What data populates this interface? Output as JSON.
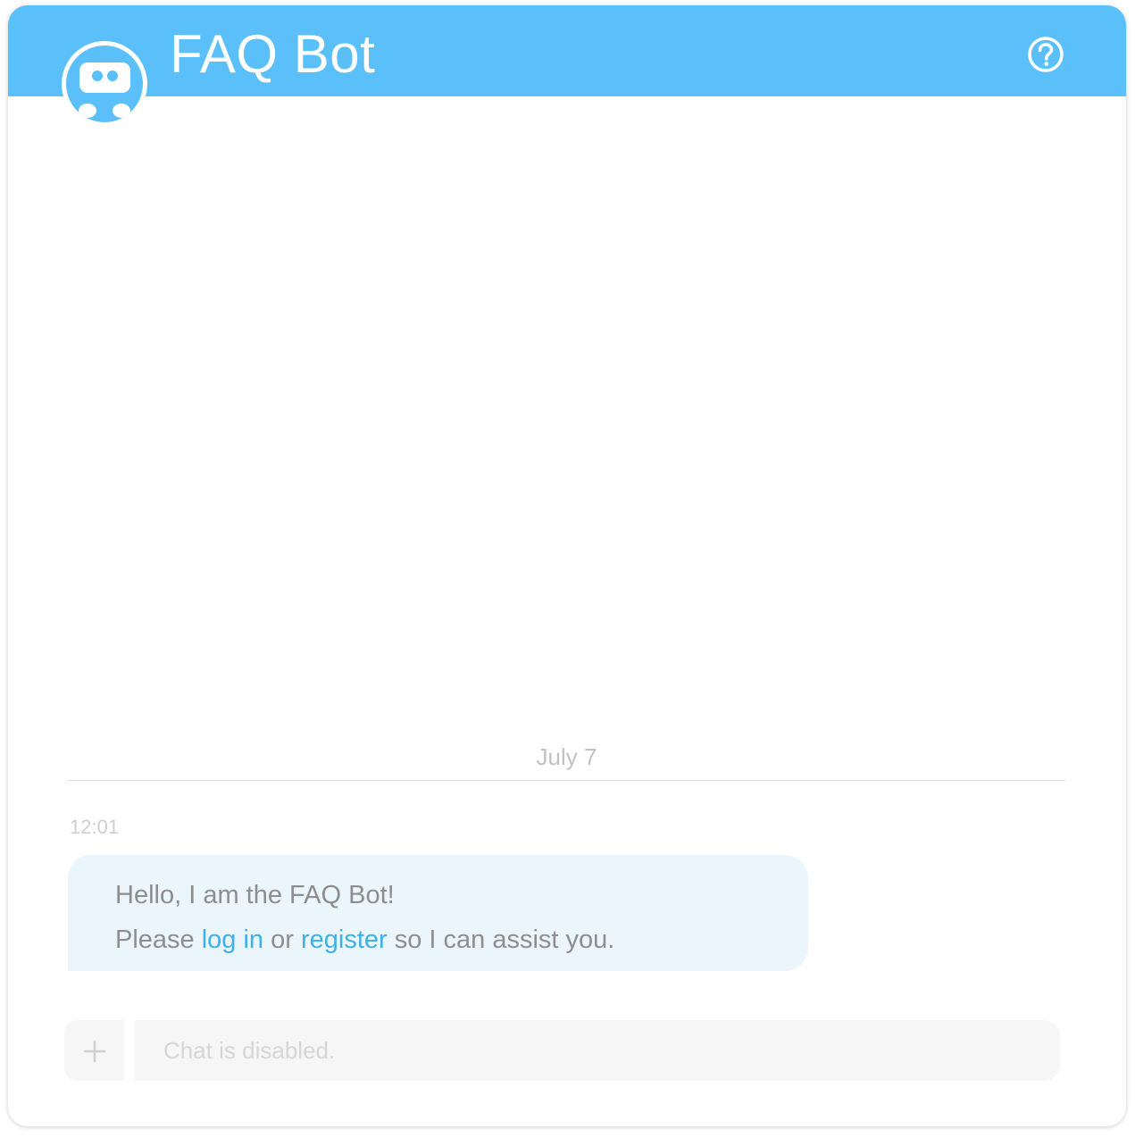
{
  "header": {
    "title": "FAQ Bot",
    "help_icon": "question-circle-icon",
    "bot_avatar_icon": "robot-face-icon",
    "background_color": "#5bbffa"
  },
  "conversation": {
    "date_divider": "July 7",
    "messages": [
      {
        "sender": "bot",
        "time": "12:01",
        "line1": "Hello, I am the FAQ Bot!",
        "line2_prefix": "Please ",
        "login_link": "log in",
        "line2_middle": " or ",
        "register_link": "register",
        "line2_suffix": " so I can assist you."
      }
    ]
  },
  "composer": {
    "attach_icon": "plus-icon",
    "placeholder": "Chat is disabled.",
    "value": ""
  },
  "colors": {
    "accent": "#5bbffa",
    "link": "#3fb0ea",
    "bubble_bg": "#eaf5fc"
  }
}
